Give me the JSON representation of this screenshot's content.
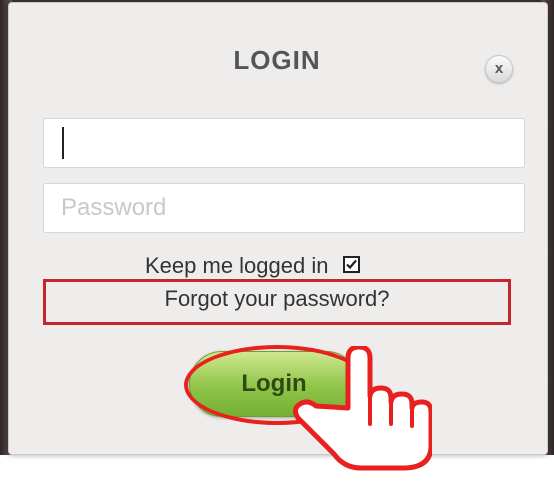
{
  "dialog": {
    "title": "LOGIN",
    "close_label": "x"
  },
  "form": {
    "username": {
      "value": "",
      "placeholder": ""
    },
    "password": {
      "value": "",
      "placeholder": "Password"
    },
    "remember": {
      "label": "Keep me logged in",
      "checked": true
    },
    "forgot_link": "Forgot your password?",
    "login_button": "Login"
  },
  "annotations": {
    "highlight_color": "#e8201f",
    "pointer_icon": "hand-pointer-icon"
  },
  "colors": {
    "dialog_background": "#efedec",
    "login_button_green": "#8fc448",
    "highlight_box_red": "#c5262d"
  }
}
